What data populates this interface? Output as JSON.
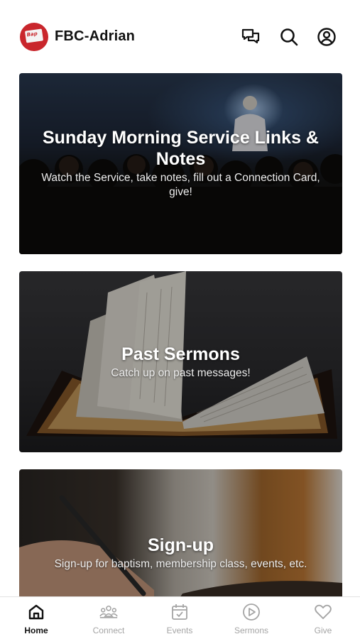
{
  "header": {
    "app_title": "FBC-Adrian",
    "logo_text": "Bap"
  },
  "cards": [
    {
      "title": "Sunday Morning Service Links & Notes",
      "subtitle": "Watch the Service, take notes, fill out a Connection Card, give!"
    },
    {
      "title": "Past Sermons",
      "subtitle": "Catch up on past messages!"
    },
    {
      "title": "Sign-up",
      "subtitle": "Sign-up for baptism, membership class, events, etc."
    }
  ],
  "tabs": [
    {
      "label": "Home",
      "icon": "home-icon",
      "active": true
    },
    {
      "label": "Connect",
      "icon": "people-icon",
      "active": false
    },
    {
      "label": "Events",
      "icon": "calendar-check-icon",
      "active": false
    },
    {
      "label": "Sermons",
      "icon": "play-circle-icon",
      "active": false
    },
    {
      "label": "Give",
      "icon": "heart-icon",
      "active": false
    }
  ],
  "colors": {
    "brand": "#c9262c",
    "tab_active": "#111111",
    "tab_inactive": "#a4a4a4"
  }
}
